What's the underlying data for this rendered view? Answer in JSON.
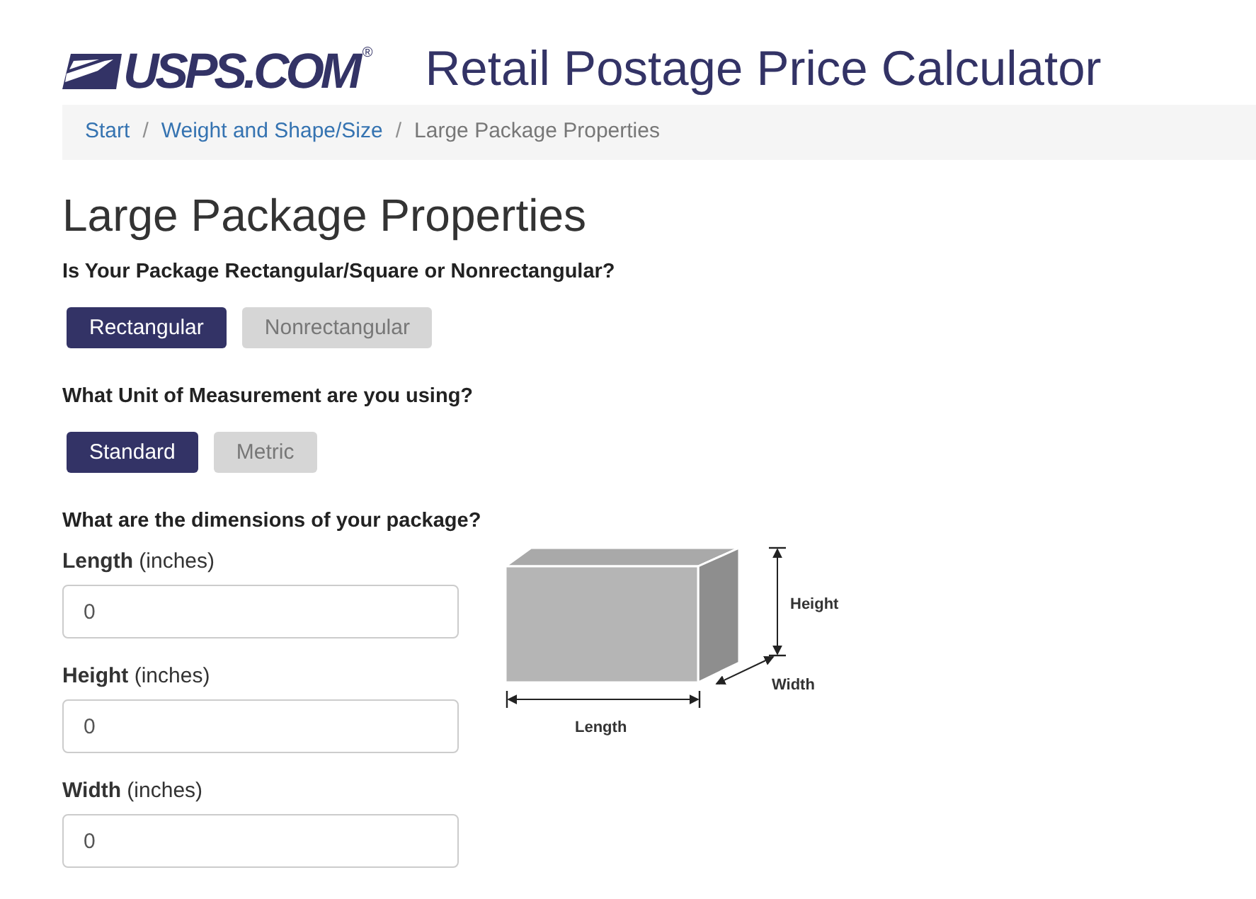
{
  "header": {
    "logo_text": "USPS.COM",
    "logo_mark": "®",
    "title": "Retail Postage Price Calculator"
  },
  "breadcrumb": [
    {
      "kind": "link",
      "label": "Start"
    },
    {
      "kind": "separator",
      "label": "/"
    },
    {
      "kind": "link",
      "label": "Weight and Shape/Size"
    },
    {
      "kind": "separator",
      "label": "/"
    },
    {
      "kind": "current",
      "label": "Large Package Properties"
    }
  ],
  "page_title": "Large Package Properties",
  "questions": [
    {
      "prompt": "Is Your Package Rectangular/Square or Nonrectangular?",
      "options": [
        {
          "label": "Rectangular",
          "selected": true
        },
        {
          "label": "Nonrectangular",
          "selected": false
        }
      ]
    },
    {
      "prompt": "What Unit of Measurement are you using?",
      "options": [
        {
          "label": "Standard",
          "selected": true
        },
        {
          "label": "Metric",
          "selected": false
        }
      ]
    }
  ],
  "dimensions": {
    "prompt": "What are the dimensions of your package?",
    "fields": [
      {
        "label": "**Length** (inches)",
        "value": "0"
      },
      {
        "label": "**Height** (inches)",
        "value": "0"
      },
      {
        "label": "**Width** (inches)",
        "value": "0"
      }
    ],
    "diagram": {
      "height_label": "Height",
      "width_label": "Width",
      "length_label": "Length"
    }
  }
}
